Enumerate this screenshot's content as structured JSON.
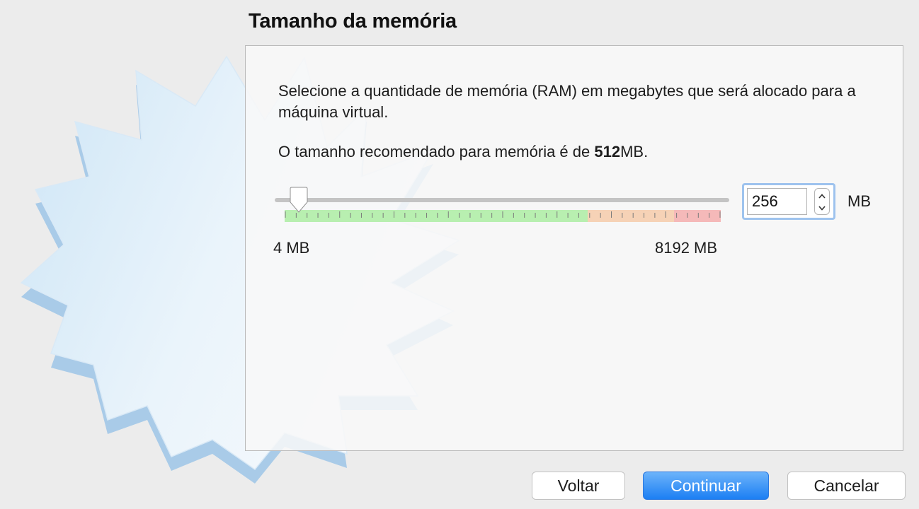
{
  "title": "Tamanho da memória",
  "description": "Selecione a quantidade de memória (RAM) em megabytes que será alocado para a máquina virtual.",
  "recommendation": {
    "prefix": "O tamanho recomendado para memória é de ",
    "value": "512",
    "suffix": "MB."
  },
  "memory": {
    "current_value": "256",
    "min_label": "4 MB",
    "max_label": "8192 MB",
    "unit": "MB",
    "min_mb": 4,
    "max_mb": 8192,
    "current_mb": 256
  },
  "buttons": {
    "back": "Voltar",
    "continue": "Continuar",
    "cancel": "Cancelar"
  },
  "colors": {
    "accent": "#1c7ff3",
    "scale_safe": "#b8efb0",
    "scale_warn": "#f6d2b6",
    "scale_danger": "#f5b9b9"
  }
}
